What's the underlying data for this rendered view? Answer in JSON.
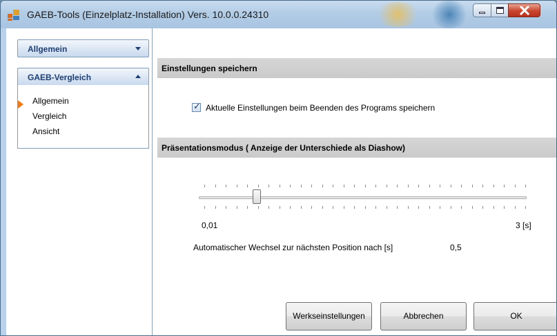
{
  "window": {
    "title": "GAEB-Tools (Einzelplatz-Installation) Vers. 10.0.0.24310",
    "controls": {
      "minimize": "minimize",
      "maximize": "maximize",
      "close": "close"
    }
  },
  "sidebar": {
    "groups": [
      {
        "label": "Allgemein",
        "expanded": false
      },
      {
        "label": "GAEB-Vergleich",
        "expanded": true,
        "items": [
          {
            "label": "Allgemein",
            "selected": true
          },
          {
            "label": "Vergleich",
            "selected": false
          },
          {
            "label": "Ansicht",
            "selected": false
          }
        ]
      }
    ]
  },
  "settings": {
    "save_section": {
      "title": "Einstellungen speichern",
      "checkbox_label": "Aktuelle Einstellungen beim Beenden des Programs speichern",
      "checked": true
    },
    "presentation_section": {
      "title": "Präsentationsmodus ( Anzeige der Unterschiede als Diashow)",
      "slider_min_label": "0,01",
      "slider_max_label": "3 [s]",
      "slider_value": 0.5,
      "auto_label": "Automatischer Wechsel zur nächsten Position nach [s]",
      "auto_value": "0,5"
    }
  },
  "buttons": {
    "defaults": "Werkseinstellungen",
    "cancel": "Abbrechen",
    "ok": "OK"
  },
  "colors": {
    "accent": "#1e3f73",
    "marker": "#f07a1a",
    "section_header": "#cfcfcf",
    "title_bar": "#b3cde6"
  }
}
